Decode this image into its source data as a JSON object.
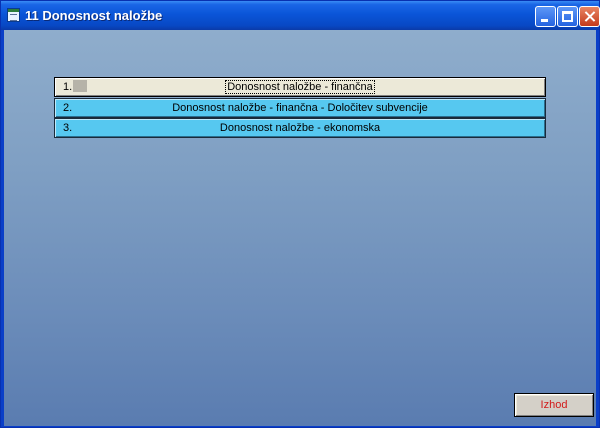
{
  "window": {
    "title": "11 Donosnost naložbe",
    "icon": "form-icon"
  },
  "menu": {
    "items": [
      {
        "number": "1.",
        "label": "Donosnost naložbe - finančna",
        "state": "selected"
      },
      {
        "number": "2.",
        "label": "Donosnost naložbe - finančna - Določitev subvencije",
        "state": "normal"
      },
      {
        "number": "3.",
        "label": "Donosnost naložbe - ekonomska",
        "state": "normal"
      }
    ]
  },
  "footer": {
    "exit_label": "Izhod"
  },
  "colors": {
    "item_normal": "#56c8f0",
    "item_selected": "#ece9d8",
    "exit_text": "#d21a1a",
    "titlebar": "#0a55d8"
  }
}
